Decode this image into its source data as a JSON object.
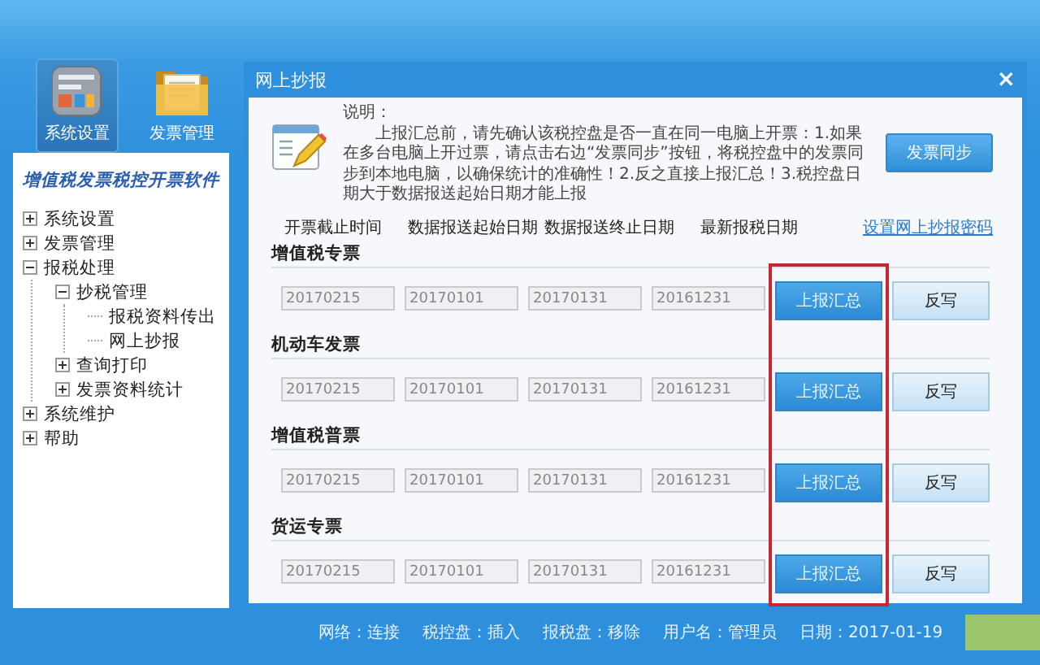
{
  "toolbar": [
    {
      "label": "系统设置",
      "kind": "settings",
      "selected": true
    },
    {
      "label": "发票管理",
      "kind": "folder",
      "selected": false
    }
  ],
  "sidebar": {
    "title": "增值税发票税控开票软件",
    "tree": [
      {
        "label": "系统设置",
        "expanded": false
      },
      {
        "label": "发票管理",
        "expanded": false
      },
      {
        "label": "报税处理",
        "expanded": true,
        "children": [
          {
            "label": "抄税管理",
            "expanded": true,
            "children": [
              {
                "label": "报税资料传出"
              },
              {
                "label": "网上抄报"
              }
            ]
          },
          {
            "label": "查询打印",
            "expanded": false
          },
          {
            "label": "发票资料统计",
            "expanded": false
          }
        ]
      },
      {
        "label": "系统维护",
        "expanded": false
      },
      {
        "label": "帮助",
        "expanded": false
      }
    ]
  },
  "window": {
    "title": "网上抄报",
    "close": "×"
  },
  "notice": {
    "heading": "说明：",
    "text": "上报汇总前，请先确认该税控盘是否一直在同一电脑上开票：1.如果在多台电脑上开过票，请点击右边“发票同步”按钮，将税控盘中的发票同步到本地电脑，以确保统计的准确性！2.反之直接上报汇总！3.税控盘日期大于数据报送起始日期才能上报"
  },
  "sync_button": "发票同步",
  "columns": [
    "开票截止时间",
    "数据报送起始日期",
    "数据报送终止日期",
    "最新报税日期"
  ],
  "password_link": "设置网上抄报密码",
  "sections": [
    {
      "title": "增值税专票",
      "fields": [
        "20170215",
        "20170101",
        "20170131",
        "20161231"
      ],
      "report_button": "上报汇总",
      "writeback_button": "反写"
    },
    {
      "title": "机动车发票",
      "fields": [
        "20170215",
        "20170101",
        "20170131",
        "20161231"
      ],
      "report_button": "上报汇总",
      "writeback_button": "反写"
    },
    {
      "title": "增值税普票",
      "fields": [
        "20170215",
        "20170101",
        "20170131",
        "20161231"
      ],
      "report_button": "上报汇总",
      "writeback_button": "反写"
    },
    {
      "title": "货运专票",
      "fields": [
        "20170215",
        "20170101",
        "20170131",
        "20161231"
      ],
      "report_button": "上报汇总",
      "writeback_button": "反写"
    }
  ],
  "report_buttons_framed": true,
  "status_bar": [
    "网络：连接",
    "税控盘：插入",
    "报税盘：移除",
    "用户名：管理员",
    "日期：2017-01-19"
  ]
}
